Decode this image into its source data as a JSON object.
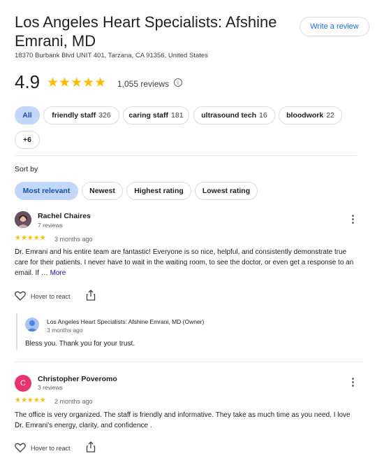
{
  "place": {
    "title": "Los Angeles Heart Specialists: Afshine Emrani, MD",
    "address": "18370 Burbank Blvd UNIT 401, Tarzana, CA 91356, United States",
    "rating": "4.9",
    "stars": "★★★★★",
    "review_count": "1,055 reviews",
    "info_icon": "ⓘ"
  },
  "write_review_label": "Write a review",
  "topics": [
    {
      "label": "All",
      "count": ""
    },
    {
      "label": "friendly staff",
      "count": "326"
    },
    {
      "label": "caring staff",
      "count": "181"
    },
    {
      "label": "ultrasound tech",
      "count": "16"
    },
    {
      "label": "bloodwork",
      "count": "22"
    },
    {
      "label": "+6",
      "count": ""
    }
  ],
  "sort": {
    "label": "Sort by",
    "options": [
      "Most relevant",
      "Newest",
      "Highest rating",
      "Lowest rating"
    ],
    "selected": "Most relevant"
  },
  "reviews": [
    {
      "name": "Rachel Chaires",
      "meta": "7 reviews",
      "stars": "★★★★★",
      "time": "3 months ago",
      "text": "Dr. Emrani and his entire team are fantastic! Everyone is so nice, helpful, and consistently demonstrate true care for their patients. I never have to wait in the waiting room, to see the doctor, or even get a response to an email. If … ",
      "more": "More",
      "react": "Hover to react",
      "owner": {
        "name": "Los Angeles Heart Specialists: Afshine Emrani, MD (Owner)",
        "time": "3 months ago",
        "reply": "Bless you. Thank you for your trust."
      }
    },
    {
      "name": "Christopher Poveromo",
      "meta": "3 reviews",
      "avatar_letter": "C",
      "stars": "★★★★★",
      "time": "2 months ago",
      "text": "The office is very organized. The staff is friendly and informative. They take as much time as you need. I love Dr. Emrani's energy, clarity, and confidence .",
      "react": "Hover to react"
    }
  ],
  "icons": {
    "heart": "heart-outline-icon",
    "share": "share-icon",
    "more": "more-vert-icon",
    "kebab_glyph": "⋮"
  },
  "colors": {
    "star": "#fbbc04",
    "chip_active_bg": "#c2d7fa",
    "link": "#1a73e8",
    "avatar_c": "#e8336d",
    "avatar_owner": "#4a86e8"
  }
}
